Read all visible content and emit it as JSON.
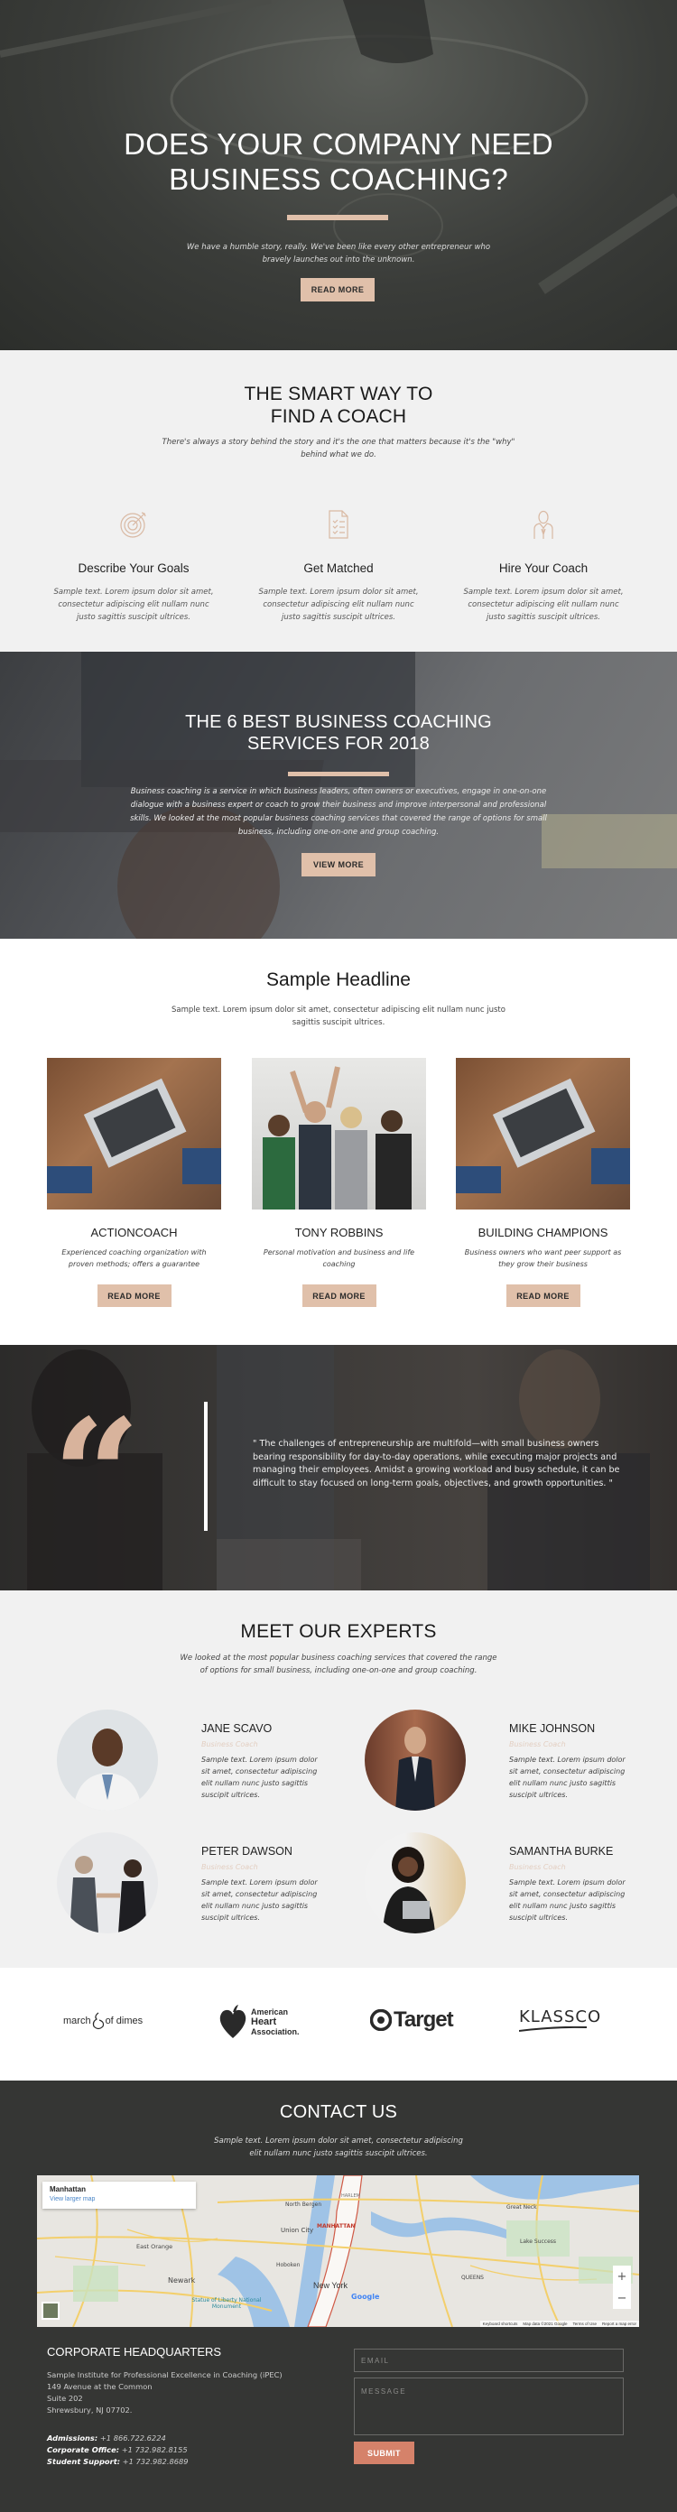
{
  "hero": {
    "title_line1": "DOES YOUR COMPANY NEED",
    "title_line2": "BUSINESS COACHING?",
    "text_line1": "We have a humble story, really. We've been like every other entrepreneur who",
    "text_line2": "bravely launches out into the unknown.",
    "button": "READ MORE"
  },
  "smart_way": {
    "title_line1": "THE SMART WAY TO",
    "title_line2": "FIND A COACH",
    "subtitle_line1": "There's always a story behind the story and it's the one that matters because it's the \"why\"",
    "subtitle_line2": "behind what we do.",
    "steps": [
      {
        "icon": "target-icon",
        "title": "Describe Your Goals",
        "text": "Sample text. Lorem ipsum dolor sit amet, consectetur adipiscing elit nullam nunc justo sagittis suscipit ultrices."
      },
      {
        "icon": "checklist-icon",
        "title": "Get Matched",
        "text": "Sample text. Lorem ipsum dolor sit amet, consectetur adipiscing elit nullam nunc justo sagittis suscipit ultrices."
      },
      {
        "icon": "businessman-icon",
        "title": "Hire Your Coach",
        "text": "Sample text. Lorem ipsum dolor sit amet, consectetur adipiscing elit nullam nunc justo sagittis suscipit ultrices."
      }
    ]
  },
  "best_services": {
    "title_line1": "THE 6 BEST BUSINESS COACHING",
    "title_line2": "SERVICES FOR 2018",
    "text": "Business coaching is a service in which business leaders, often owners or executives, engage in one-on-one dialogue with a business expert or coach to grow their business and improve interpersonal and professional skills. We looked at the most popular business coaching services that covered the range of options for small business, including one-on-one and group coaching.",
    "button": "VIEW MORE"
  },
  "headline": {
    "title": "Sample Headline",
    "text_line1": "Sample text. Lorem ipsum dolor sit amet, consectetur adipiscing elit nullam nunc justo",
    "text_line2": "sagittis suscipit ultrices.",
    "cards": [
      {
        "title": "ACTIONCOACH",
        "text": "Experienced coaching organization with proven methods; offers a guarantee",
        "button": "READ MORE"
      },
      {
        "title": "TONY ROBBINS",
        "text": "Personal motivation and business and life coaching",
        "button": "READ MORE"
      },
      {
        "title": "BUILDING CHAMPIONS",
        "text": "Business owners who want peer support as they grow their business",
        "button": "READ MORE"
      }
    ]
  },
  "quote": {
    "mark": "“",
    "text": "\" The challenges of entrepreneurship are multifold—with small business owners bearing responsibility for day-to-day operations, while executing major projects and managing their employees. Amidst a growing workload and busy schedule, it can be difficult to stay focused on long-term goals, objectives, and growth opportunities. \""
  },
  "experts": {
    "title": "MEET OUR EXPERTS",
    "subtitle_line1": "We looked at the most popular business coaching services that covered the range",
    "subtitle_line2": "of options for small business, including one-on-one and group coaching.",
    "people": [
      {
        "name": "JANE SCAVO",
        "role": "Business Coach",
        "text": "Sample text. Lorem ipsum dolor sit amet, consectetur adipiscing elit nullam nunc justo sagittis suscipit ultrices."
      },
      {
        "name": "MIKE JOHNSON",
        "role": "Business Coach",
        "text": "Sample text. Lorem ipsum dolor sit amet, consectetur adipiscing elit nullam nunc justo sagittis suscipit ultrices."
      },
      {
        "name": "PETER DAWSON",
        "role": "Business Coach",
        "text": "Sample text. Lorem ipsum dolor sit amet, consectetur adipiscing elit nullam nunc justo sagittis suscipit ultrices."
      },
      {
        "name": "SAMANTHA BURKE",
        "role": "Business Coach",
        "text": "Sample text. Lorem ipsum dolor sit amet, consectetur adipiscing elit nullam nunc justo sagittis suscipit ultrices."
      }
    ]
  },
  "logos": {
    "march_of_dimes": {
      "left": "march",
      "right": "of dimes"
    },
    "aha": {
      "line1": "American",
      "line2": "Heart",
      "line3": "Association."
    },
    "target": "Target",
    "klassco": "KLASSCO"
  },
  "contact": {
    "title": "CONTACT US",
    "text_line1": "Sample text. Lorem ipsum dolor sit amet, consectetur adipiscing",
    "text_line2": "elit nullam nunc justo sagittis suscipit ultrices.",
    "map": {
      "place": "Manhattan",
      "link": "View larger map",
      "labels": [
        "MANHATTAN",
        "New York",
        "Newark",
        "Union City",
        "Hoboken",
        "North Bergen",
        "QUEENS",
        "Great Neck",
        "Statue of Liberty National Monument",
        "East Orange",
        "HARLEM",
        "Lake Success"
      ],
      "footer": [
        "Keyboard shortcuts",
        "Map data ©2021 Google",
        "Terms of Use",
        "Report a map error"
      ],
      "google": "Google",
      "zoom_in": "+",
      "zoom_out": "−"
    },
    "hq_title": "CORPORATE HEADQUARTERS",
    "address": [
      "Sample Institute for Professional Excellence in Coaching (iPEC)",
      "149 Avenue at the Common",
      "Suite 202",
      "Shrewsbury, NJ 07702."
    ],
    "phones": [
      {
        "label": "Admissions:",
        "value": " +1 866.722.6224"
      },
      {
        "label": "Corporate Office:",
        "value": " +1 732.982.8155"
      },
      {
        "label": "Student Support:",
        "value": " +1 732.982.8689"
      }
    ],
    "email_placeholder": "EMAIL",
    "message_placeholder": "MESSAGE",
    "submit": "SUBMIT"
  },
  "colors": {
    "accent": "#e0c0aa",
    "submit": "#d5826a",
    "dark": "#353634",
    "light": "#f1f1f1"
  }
}
